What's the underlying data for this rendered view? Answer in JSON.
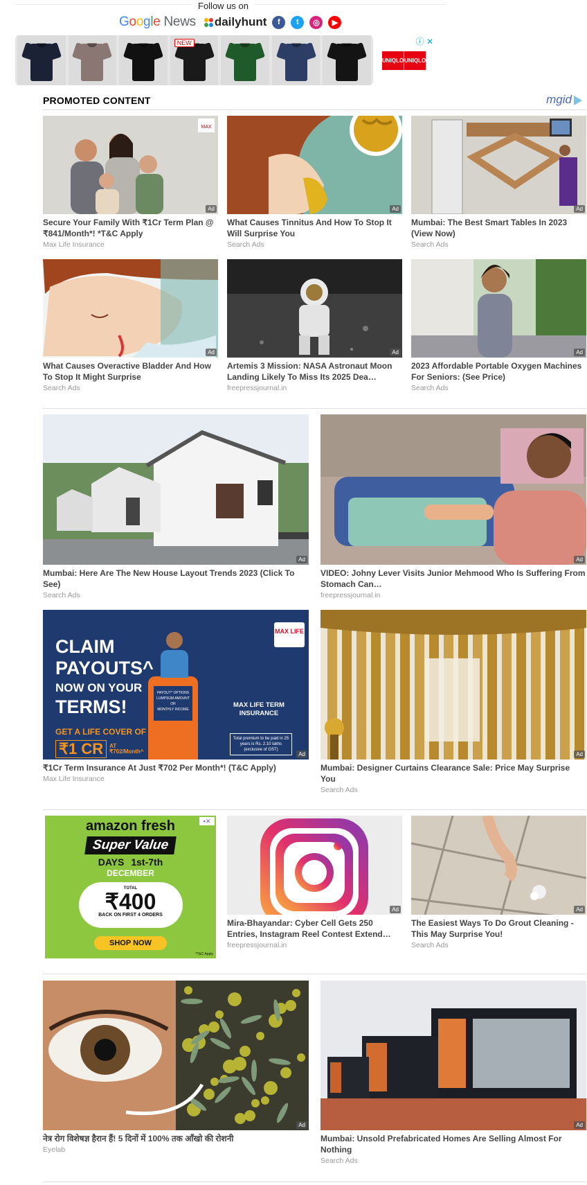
{
  "follow": {
    "label": "Follow us on",
    "google_news": {
      "g": "G",
      "o1": "o",
      "o2": "o",
      "g2": "g",
      "l": "l",
      "e": "e",
      "news": " News"
    },
    "dailyhunt": "dailyhunt",
    "social": [
      {
        "name": "facebook",
        "glyph": "f",
        "color": "#3b5998"
      },
      {
        "name": "twitter",
        "glyph": "t",
        "color": "#1da1f2"
      },
      {
        "name": "instagram",
        "glyph": "◎",
        "color": "#d6247c"
      },
      {
        "name": "youtube",
        "glyph": "▶",
        "color": "#ff0000"
      }
    ]
  },
  "banner": {
    "shirts": [
      {
        "color": "#1c2236",
        "tag": ""
      },
      {
        "color": "#8a7672",
        "tag": ""
      },
      {
        "color": "#111111",
        "tag": ""
      },
      {
        "color": "#1a1a1a",
        "tag": "NEW"
      },
      {
        "color": "#1e5a2a",
        "tag": ""
      },
      {
        "color": "#2c3e66",
        "tag": ""
      },
      {
        "color": "#141414",
        "tag": ""
      }
    ],
    "adchoices": "ⓘ ✕",
    "brand": [
      "UNI",
      "QLO",
      "UNI",
      "QLO"
    ]
  },
  "promoted": {
    "title": "PROMOTED CONTENT",
    "provider": "mgid",
    "ad_label": "Ad"
  },
  "rows": [
    [
      {
        "title": "Secure Your Family With ₹1Cr Term Plan @ ₹841/Month*! *T&C Apply",
        "source": "Max Life Insurance",
        "art": "family"
      },
      {
        "title": "What Causes Tinnitus And How To Stop It Will Surprise You",
        "source": "Search Ads",
        "art": "ear"
      },
      {
        "title": "Mumbai: The Best Smart Tables In 2023 (View Now)",
        "source": "Search Ads",
        "art": "table"
      }
    ],
    [
      {
        "title": "What Causes Overactive Bladder And How To Stop It Might Surprise",
        "source": "Search Ads",
        "art": "sleep"
      },
      {
        "title": "Artemis 3 Mission: NASA Astronaut Moon Landing Likely To Miss Its 2025 Dea…",
        "source": "freepressjournal.in",
        "art": "moon"
      },
      {
        "title": "2023 Affordable Portable Oxygen Machines For Seniors: (See Price)",
        "source": "Search Ads",
        "art": "woman"
      }
    ],
    [
      {
        "title": "Mumbai: Here Are The New House Layout Trends 2023 (Click To See)",
        "source": "Search Ads",
        "art": "houses"
      },
      {
        "title": "VIDEO: Johny Lever Visits Junior Mehmood Who Is Suffering From Stomach Can…",
        "source": "freepressjournal.in",
        "art": "video"
      }
    ],
    [
      {
        "title": "₹1Cr Term Insurance At Just ₹702 Per Month*! (T&C Apply)",
        "source": "Max Life Insurance",
        "art": "claim"
      },
      {
        "title": "Mumbai: Designer Curtains Clearance Sale: Price May Surprise You",
        "source": "Search Ads",
        "art": "curtains"
      }
    ],
    [
      {
        "title": "",
        "source": "",
        "art": "amazon"
      },
      {
        "title": "Mira-Bhayandar: Cyber Cell Gets 250 Entries, Instagram Reel Contest Extend…",
        "source": "freepressjournal.in",
        "art": "insta"
      },
      {
        "title": "The Easiest Ways To Do Grout Cleaning - This May Surprise You!",
        "source": "Search Ads",
        "art": "grout"
      }
    ],
    [
      {
        "title": "नेत्र रोग विशेषज्ञ हैरान हैं! 5 दिनों में 100% तक आँखो की रोशनी",
        "source": "Eyelab",
        "art": "eye"
      },
      {
        "title": "Mumbai: Unsold Prefabricated Homes Are Selling Almost For Nothing",
        "source": "Search Ads",
        "art": "prefab"
      }
    ]
  ],
  "claim_ad": {
    "line1": "CLAIM",
    "line2": "PAYOUTS^",
    "line3": "NOW ON YOUR",
    "line4": "TERMS!",
    "cover": "GET A LIFE COVER OF",
    "amount": "₹1 CR",
    "at": "AT ₹702/Month^",
    "brand": "MAX LIFE",
    "product": "MAX LIFE TERM INSURANCE",
    "atm1": "PAYOUT^ OPTIONS",
    "atm2": "LUMPSUM AMOUNT",
    "atm3": "OR",
    "atm4": "MONTHLY INCOME",
    "note": "Total premium to be paid in 25 years is Rs. 2.10 lakhs (exclusive of GST)"
  },
  "amazon_ad": {
    "brand": "amazon fresh",
    "headline": "Super Value",
    "days": "DAYS",
    "dates": "1st-7th",
    "month": "DECEMBER",
    "total": "TOTAL",
    "amount": "₹400",
    "back": "BACK ON FIRST 4 ORDERS",
    "cta": "SHOP NOW",
    "tc": "*T&C Apply"
  }
}
